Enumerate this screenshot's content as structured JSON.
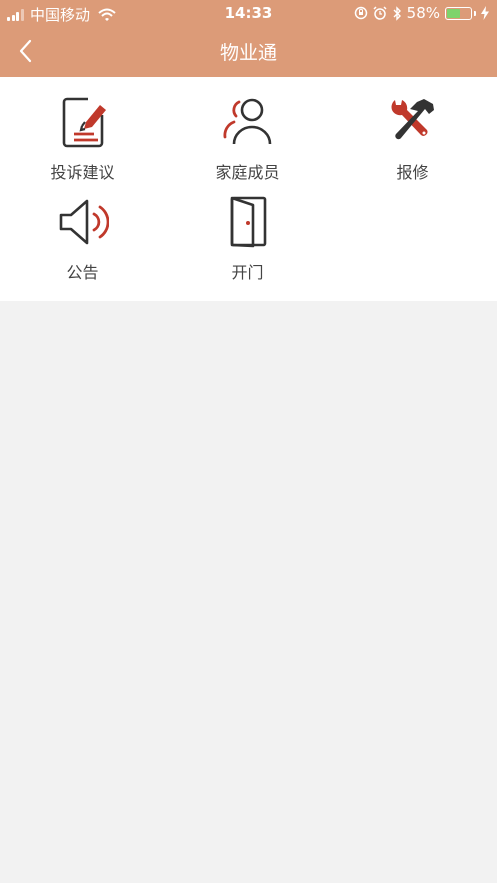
{
  "status_bar": {
    "carrier": "中国移动",
    "time": "14:33",
    "battery_percent": "58%",
    "battery_level": 0.58
  },
  "nav": {
    "title": "物业通"
  },
  "menu": [
    {
      "label": "投诉建议",
      "icon": "complaint-icon"
    },
    {
      "label": "家庭成员",
      "icon": "family-members-icon"
    },
    {
      "label": "报修",
      "icon": "repair-icon"
    },
    {
      "label": "公告",
      "icon": "announcement-icon"
    },
    {
      "label": "开门",
      "icon": "door-icon"
    }
  ],
  "colors": {
    "header": "#dc9b78",
    "accent": "#c0392b",
    "icon_dark": "#333333"
  }
}
